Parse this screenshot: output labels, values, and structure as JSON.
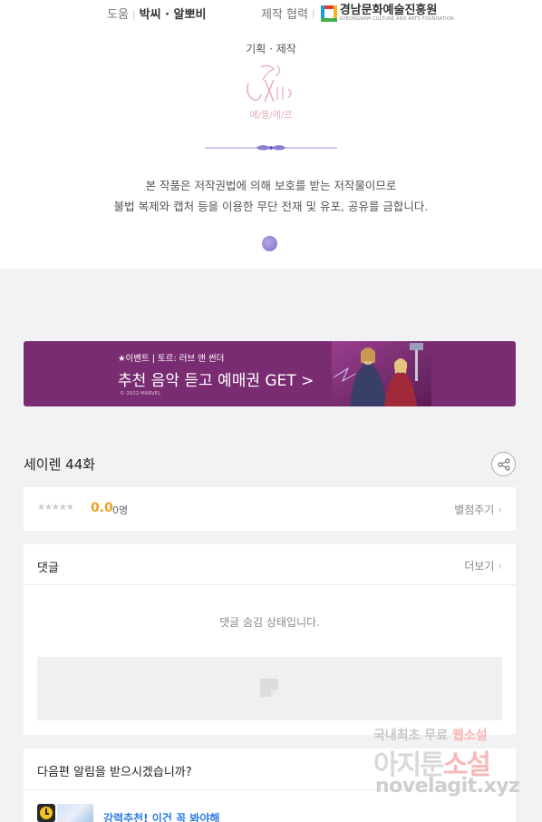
{
  "credits": {
    "assist_label": "도움",
    "assist_names": "박씨 · 알뽀비",
    "collab_label": "제작 협력",
    "collab_org_ko": "경남문화예술진흥원",
    "collab_org_en": "GYEONGNAM CULTURE AND ARTS FOUNDATION",
    "planning_label": "기획 · 제작",
    "studio_logo_text": "에/뜰/레/르",
    "copyright_line1": "본 작품은 저작권법에 의해 보호를 받는 저작물이므로",
    "copyright_line2": "불법 복제와 캡처 등을 이용한 무단 전재 및 유포, 공유를 금합니다."
  },
  "banner": {
    "small_text": "★이벤트 | 토르: 러브 앤 썬더",
    "title": "추천 음악 듣고 예매권 GET >",
    "copyright": "© 2022 MARVEL",
    "background_color": "#7a2c72"
  },
  "episode": {
    "title": "세이렌 44화",
    "share_icon": "share-icon"
  },
  "rating": {
    "stars": "★★★★★",
    "score": "0.0",
    "count": "0명",
    "rate_link": "별점주기"
  },
  "comments": {
    "title": "댓글",
    "more_link": "더보기",
    "hidden_message": "댓글 숨김 상태입니다."
  },
  "notify": {
    "question": "다음편 알림을 받으시겠습니까?",
    "recommend_text": "강력추천! 이건 꼭 봐야해"
  },
  "watermark": {
    "line1_a": "국내최초 무료",
    "line1_b": "웹소설",
    "line2_a": "아지툰",
    "line2_b": "소설",
    "line3": "novelagit.xyz"
  },
  "colors": {
    "accent_orange": "#f0a020",
    "link_blue": "#2c7be5",
    "banner_purple": "#7a2c72"
  }
}
